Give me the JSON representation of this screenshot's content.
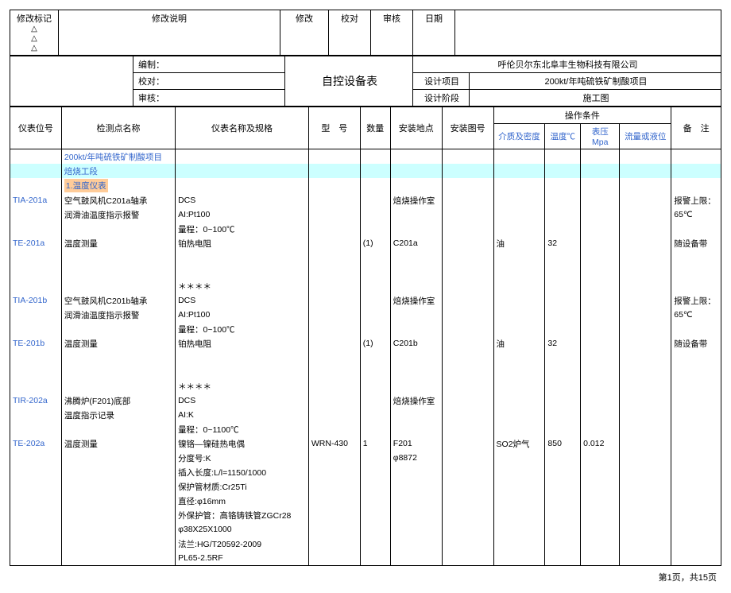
{
  "top": {
    "mark_label": "修改标记",
    "triangle": "△",
    "desc_label": "修改说明",
    "mod_label": "修改",
    "check_label": "校对",
    "review_label": "审核",
    "date_label": "日期"
  },
  "header": {
    "compile": "编制：",
    "verify": "校对：",
    "audit": "审核：",
    "title": "自控设备表",
    "company": "呼伦贝尔东北阜丰生物科技有限公司",
    "design_proj_label": "设计项目",
    "design_proj": "200kt/年吨硫铁矿制酸项目",
    "design_stage_label": "设计阶段",
    "design_stage": "施工图"
  },
  "columns": {
    "tag": "仪表位号",
    "point": "检测点名称",
    "spec": "仪表名称及规格",
    "model": "型　号",
    "qty": "数量",
    "loc": "安装地点",
    "dwg": "安装图号",
    "op": "操作条件",
    "remarks": "备　注",
    "op_sub": {
      "medium": "介质及密度",
      "temp": "温度℃",
      "press": "表压Mpa",
      "flow": "流量或液位"
    }
  },
  "sections": {
    "proj_line": "200kt/年吨硫铁矿制酸项目",
    "stage_line": "焙烧工段",
    "group1": "1.温度仪表"
  },
  "rows": [
    {
      "tag": "TIA-201a",
      "point1": "空气鼓风机C201a轴承",
      "point2": "润滑油温度指示报警",
      "spec1": "DCS",
      "spec2": "AI:Pt100",
      "spec3": "量程：0~100℃",
      "loc": "焙烧操作室",
      "remark1": "报警上限：",
      "remark2": "65℃"
    },
    {
      "tag": "TE-201a",
      "point": "温度测量",
      "spec": "铂热电阻",
      "qty": "(1)",
      "loc": "C201a",
      "medium": "油",
      "temp": "32",
      "remark": "随设备带"
    },
    {
      "sep": "＊＊＊＊"
    },
    {
      "tag": "TIA-201b",
      "point1": "空气鼓风机C201b轴承",
      "point2": "润滑油温度指示报警",
      "spec1": "DCS",
      "spec2": "AI:Pt100",
      "spec3": "量程：0~100℃",
      "loc": "焙烧操作室",
      "remark1": "报警上限：",
      "remark2": "65℃"
    },
    {
      "tag": "TE-201b",
      "point": "温度测量",
      "spec": "铂热电阻",
      "qty": "(1)",
      "loc": "C201b",
      "medium": "油",
      "temp": "32",
      "remark": "随设备带"
    },
    {
      "sep": "＊＊＊＊"
    },
    {
      "tag": "TIR-202a",
      "point1": "沸腾炉(F201)底部",
      "point2": "温度指示记录",
      "spec1": "DCS",
      "spec2": "AI:K",
      "spec3": "量程：0~1100℃",
      "loc": "焙烧操作室"
    },
    {
      "tag": "TE-202a",
      "point": "温度测量",
      "spec_lines": [
        "镍铬—镍硅热电偶",
        "分度号:K",
        "插入长度:L/l=1150/1000",
        "保护管材质:Cr25Ti",
        "直径:φ16mm",
        "外保护管：高铬铸铁管ZGCr28",
        "φ38X25X1000",
        "法兰:HG/T20592-2009",
        "PL65-2.5RF"
      ],
      "model": "WRN-430",
      "qty": "1",
      "loc": "F201",
      "loc2": "φ8872",
      "medium": "SO2炉气",
      "temp": "850",
      "press": "0.012"
    }
  ],
  "footer": "第1页，共15页"
}
